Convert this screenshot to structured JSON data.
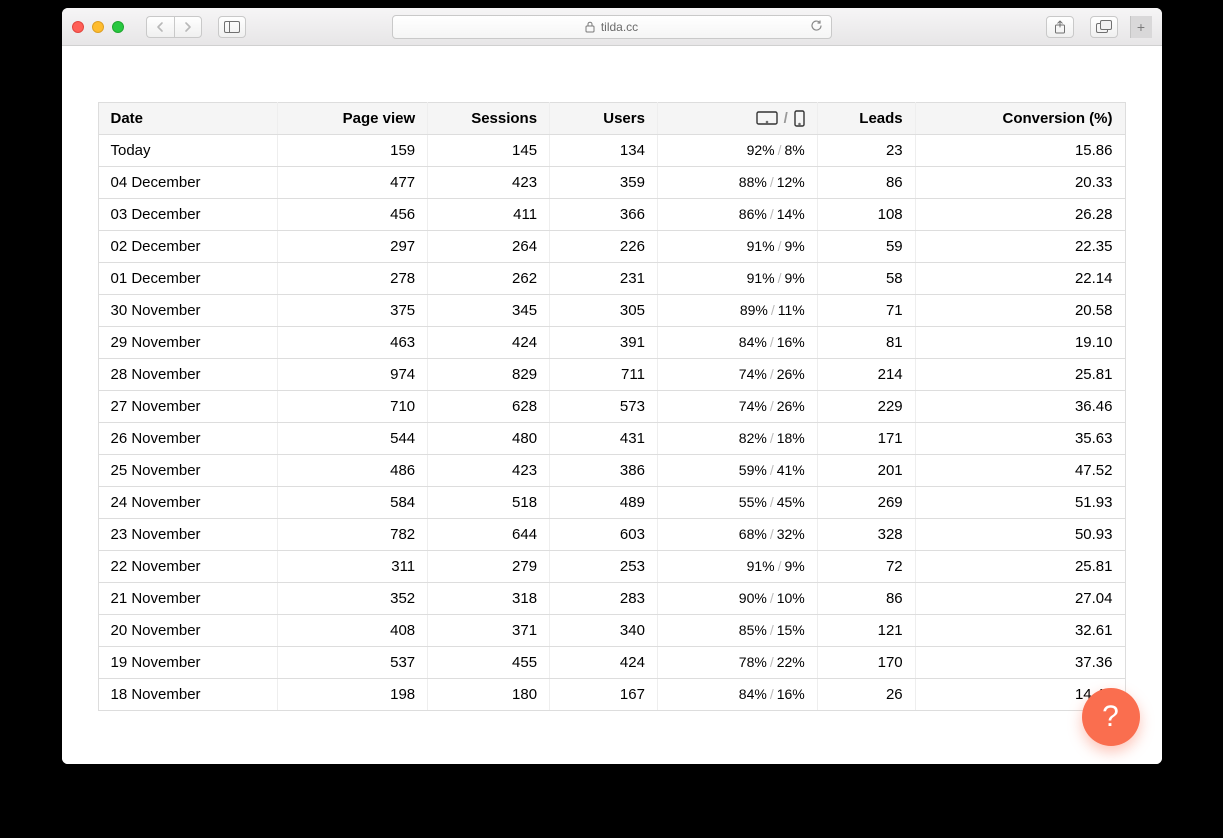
{
  "browser": {
    "url_host": "tilda.cc"
  },
  "table": {
    "headers": {
      "date": "Date",
      "page_view": "Page view",
      "sessions": "Sessions",
      "users": "Users",
      "leads": "Leads",
      "conversion": "Conversion (%)"
    },
    "rows": [
      {
        "date": "Today",
        "pv": "159",
        "sess": "145",
        "users": "134",
        "desk": "92%",
        "mob": "8%",
        "leads": "23",
        "conv": "15.86"
      },
      {
        "date": "04 December",
        "pv": "477",
        "sess": "423",
        "users": "359",
        "desk": "88%",
        "mob": "12%",
        "leads": "86",
        "conv": "20.33"
      },
      {
        "date": "03 December",
        "pv": "456",
        "sess": "411",
        "users": "366",
        "desk": "86%",
        "mob": "14%",
        "leads": "108",
        "conv": "26.28"
      },
      {
        "date": "02 December",
        "pv": "297",
        "sess": "264",
        "users": "226",
        "desk": "91%",
        "mob": "9%",
        "leads": "59",
        "conv": "22.35"
      },
      {
        "date": "01 December",
        "pv": "278",
        "sess": "262",
        "users": "231",
        "desk": "91%",
        "mob": "9%",
        "leads": "58",
        "conv": "22.14"
      },
      {
        "date": "30 November",
        "pv": "375",
        "sess": "345",
        "users": "305",
        "desk": "89%",
        "mob": "11%",
        "leads": "71",
        "conv": "20.58"
      },
      {
        "date": "29 November",
        "pv": "463",
        "sess": "424",
        "users": "391",
        "desk": "84%",
        "mob": "16%",
        "leads": "81",
        "conv": "19.10"
      },
      {
        "date": "28 November",
        "pv": "974",
        "sess": "829",
        "users": "711",
        "desk": "74%",
        "mob": "26%",
        "leads": "214",
        "conv": "25.81"
      },
      {
        "date": "27 November",
        "pv": "710",
        "sess": "628",
        "users": "573",
        "desk": "74%",
        "mob": "26%",
        "leads": "229",
        "conv": "36.46"
      },
      {
        "date": "26 November",
        "pv": "544",
        "sess": "480",
        "users": "431",
        "desk": "82%",
        "mob": "18%",
        "leads": "171",
        "conv": "35.63"
      },
      {
        "date": "25 November",
        "pv": "486",
        "sess": "423",
        "users": "386",
        "desk": "59%",
        "mob": "41%",
        "leads": "201",
        "conv": "47.52"
      },
      {
        "date": "24 November",
        "pv": "584",
        "sess": "518",
        "users": "489",
        "desk": "55%",
        "mob": "45%",
        "leads": "269",
        "conv": "51.93"
      },
      {
        "date": "23 November",
        "pv": "782",
        "sess": "644",
        "users": "603",
        "desk": "68%",
        "mob": "32%",
        "leads": "328",
        "conv": "50.93"
      },
      {
        "date": "22 November",
        "pv": "311",
        "sess": "279",
        "users": "253",
        "desk": "91%",
        "mob": "9%",
        "leads": "72",
        "conv": "25.81"
      },
      {
        "date": "21 November",
        "pv": "352",
        "sess": "318",
        "users": "283",
        "desk": "90%",
        "mob": "10%",
        "leads": "86",
        "conv": "27.04"
      },
      {
        "date": "20 November",
        "pv": "408",
        "sess": "371",
        "users": "340",
        "desk": "85%",
        "mob": "15%",
        "leads": "121",
        "conv": "32.61"
      },
      {
        "date": "19 November",
        "pv": "537",
        "sess": "455",
        "users": "424",
        "desk": "78%",
        "mob": "22%",
        "leads": "170",
        "conv": "37.36"
      },
      {
        "date": "18 November",
        "pv": "198",
        "sess": "180",
        "users": "167",
        "desk": "84%",
        "mob": "16%",
        "leads": "26",
        "conv": "14.44"
      }
    ]
  },
  "help": {
    "label": "?"
  }
}
